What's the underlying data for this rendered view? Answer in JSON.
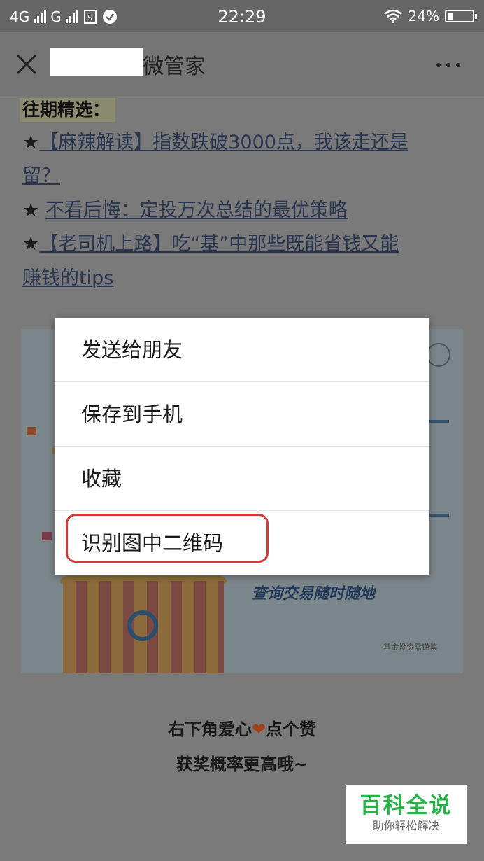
{
  "status_bar": {
    "network_1": "4G",
    "network_2": "G",
    "time": "22:29",
    "battery": "24%",
    "battery_level": 0.24
  },
  "nav_bar": {
    "title": "微管家",
    "close_icon": "close-icon",
    "more_icon": "more-icon"
  },
  "article": {
    "section_heading": "往期精选：",
    "star": "★",
    "items": [
      {
        "text_line1": "【麻辣解读】指数跌破3000点，我该走还是",
        "text_line2": "留？"
      },
      {
        "text": "不看后悔：定投万次总结的最优策略"
      },
      {
        "text_line1": "【老司机上路】吃“基”中那些既能省钱又能",
        "text_line2": "赚钱的tips"
      }
    ],
    "banner": {
      "slogan": "查询交易随时随地",
      "foot": "基金投资需谨慎"
    },
    "footer_line1_a": "右下角爱心",
    "footer_heart": "❤",
    "footer_line1_b": "点个赞",
    "footer_line2": "获奖概率更高哦~"
  },
  "context_menu": {
    "items": [
      "发送给朋友",
      "保存到手机",
      "收藏",
      "识别图中二维码"
    ]
  },
  "watermark": {
    "main": "百科全说",
    "sub": "助你轻松解决"
  },
  "colors": {
    "highlight": "#d23a3a",
    "watermark_green": "#27b34a",
    "overlay": "#7a7a7a"
  }
}
